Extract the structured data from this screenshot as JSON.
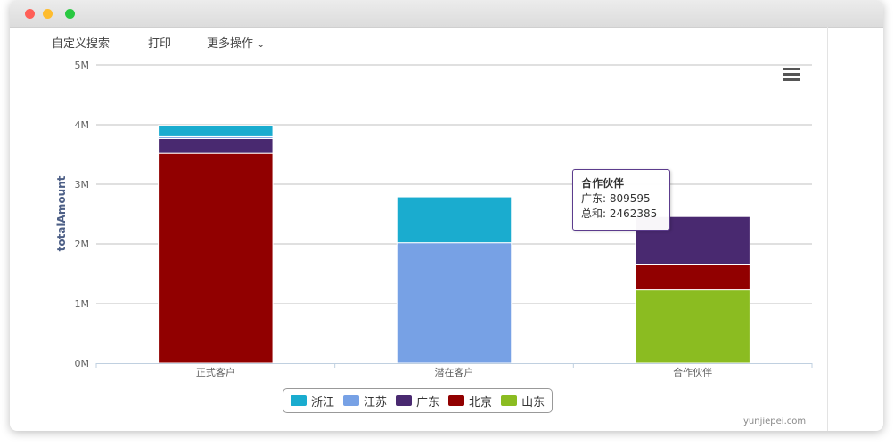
{
  "toolbar": {
    "custom_search": "自定义搜索",
    "print": "打印",
    "more_actions": "更多操作",
    "more_actions_chevron": "⌄"
  },
  "credit": "yunjiepei.com",
  "tooltip": {
    "title": "合作伙伴",
    "line1_label": "广东",
    "line1_value": "809595",
    "line2_label": "总和",
    "line2_value": "2462385"
  },
  "chart_data": {
    "type": "bar",
    "stacked": true,
    "categories": [
      "正式客户",
      "潜在客户",
      "合作伙伴"
    ],
    "ylabel": "totalAmount",
    "xlabel": "",
    "ylim": [
      0,
      5000000
    ],
    "yticks": [
      "0M",
      "1M",
      "2M",
      "3M",
      "4M",
      "5M"
    ],
    "grid": true,
    "legend_position": "bottom-center",
    "series": [
      {
        "name": "浙江",
        "color": "#1aaccf",
        "values": [
          190000,
          770000,
          0
        ]
      },
      {
        "name": "江苏",
        "color": "#77a1e5",
        "values": [
          30000,
          2020000,
          0
        ]
      },
      {
        "name": "广东",
        "color": "#492970",
        "values": [
          250000,
          0,
          809595
        ]
      },
      {
        "name": "北京",
        "color": "#910000",
        "values": [
          3520000,
          0,
          420000
        ]
      },
      {
        "name": "山东",
        "color": "#8bbc21",
        "values": [
          0,
          0,
          1230000
        ]
      }
    ]
  }
}
